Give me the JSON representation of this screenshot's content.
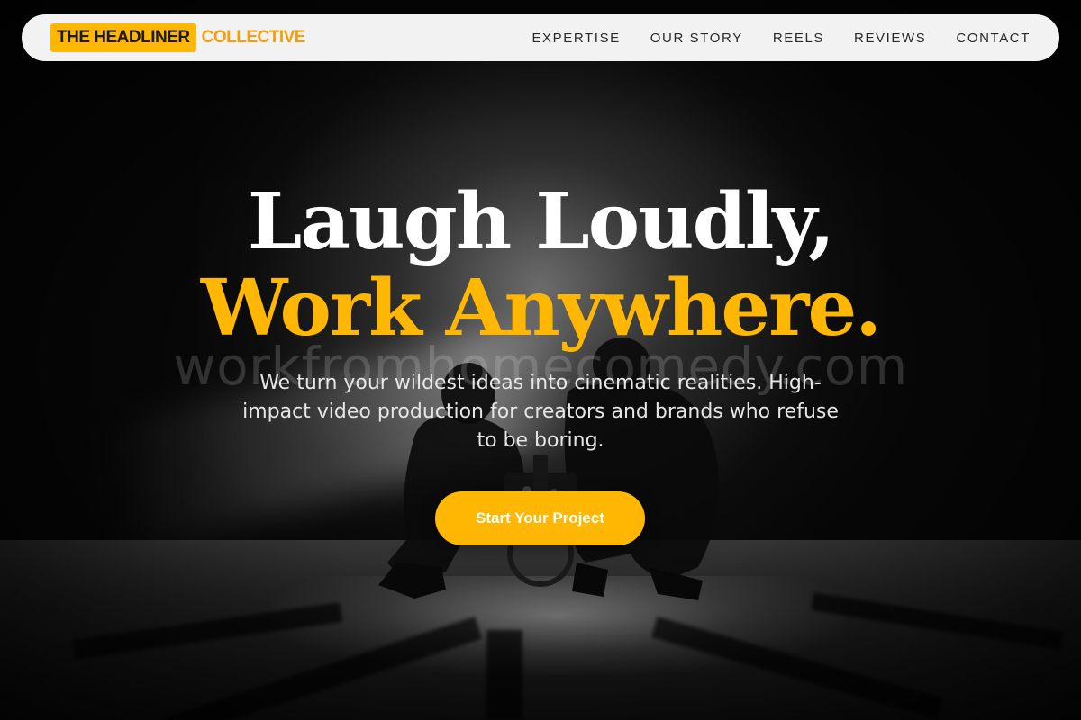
{
  "brand": {
    "primary": "THE HEADLINER",
    "secondary": "COLLECTIVE"
  },
  "nav": {
    "links": [
      "EXPERTISE",
      "OUR STORY",
      "REELS",
      "REVIEWS",
      "CONTACT"
    ]
  },
  "hero": {
    "headline_line1": "Laugh Loudly,",
    "headline_line2": "Work Anywhere.",
    "watermark": "workfromhomecomedy.com",
    "subtitle": "We turn your wildest ideas into cinematic realities. High-impact video production for creators and brands who refuse to be boring.",
    "cta_label": "Start Your Project"
  },
  "colors": {
    "accent": "#FFB703",
    "logo_secondary": "#F59E0B",
    "nav_background": "#F2F2F2",
    "background": "#070707",
    "headline": "#FFFFFF"
  }
}
